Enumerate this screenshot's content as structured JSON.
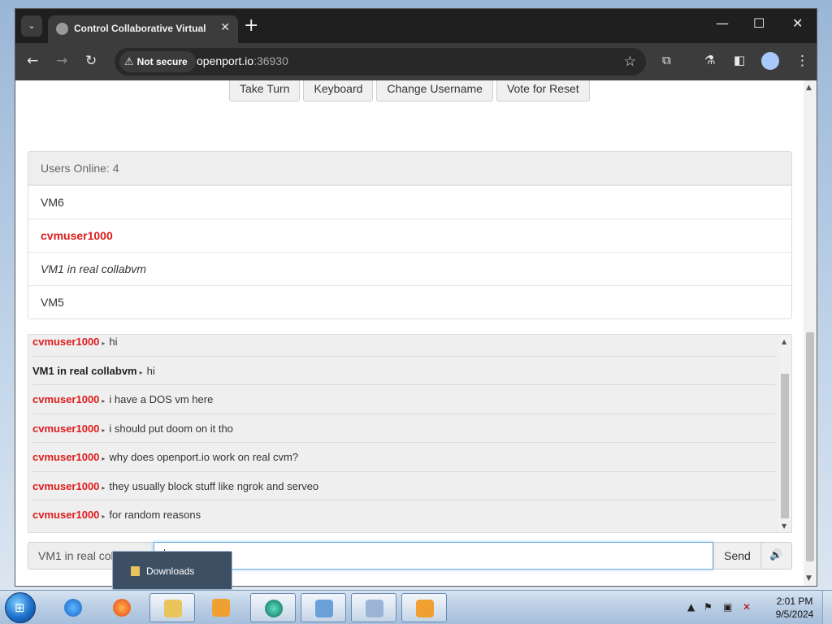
{
  "browser": {
    "tab_search_glyph": "⌄",
    "tab_title": "Control Collaborative Virtual M",
    "tab_close": "✕",
    "new_tab": "+",
    "minimize": "—",
    "maximize": "☐",
    "close": "✕",
    "back": "←",
    "forward": "→",
    "reload": "↻",
    "security_label": "Not secure",
    "url_host": "openport.io",
    "url_port": ":36930",
    "bookmark_star": "☆",
    "menu_dots": "⋮"
  },
  "controls": {
    "take_turn": "Take Turn",
    "keyboard": "Keyboard",
    "change_username": "Change Username",
    "vote_reset": "Vote for Reset"
  },
  "users": {
    "header": "Users Online: 4",
    "list": [
      "VM6",
      "cvmuser1000",
      "VM1 in real collabvm",
      "VM5"
    ]
  },
  "chat": {
    "messages": [
      {
        "user": "cvmuser1000",
        "text": "hi"
      },
      {
        "user": "VM1 in real collabvm",
        "text": "hi"
      },
      {
        "user": "cvmuser1000",
        "text": "i have a DOS vm here"
      },
      {
        "user": "cvmuser1000",
        "text": "i should put doom on it tho"
      },
      {
        "user": "cvmuser1000",
        "text": "why does openport.io work on real cvm?"
      },
      {
        "user": "cvmuser1000",
        "text": "they usually block stuff like ngrok and serveo"
      },
      {
        "user": "cvmuser1000",
        "text": "for random reasons"
      }
    ],
    "separator": "▸",
    "username_label": "VM1 in real collabvm",
    "input_value": "",
    "send_label": "Send",
    "sound_icon": "🔊"
  },
  "taskbar": {
    "start_glyph": "⊞",
    "peek_label": "Downloads",
    "time": "2:01 PM",
    "date": "9/5/2024"
  },
  "colors": {
    "my_user": "#dd1c1c",
    "focus_border": "#66afe9",
    "browser_dark": "#1f1f1f"
  }
}
